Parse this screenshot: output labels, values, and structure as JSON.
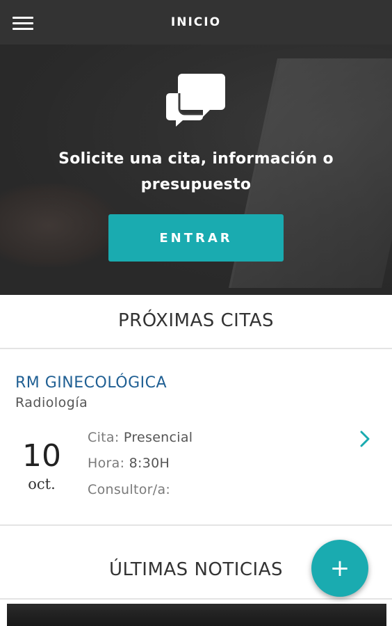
{
  "header": {
    "title": "INICIO",
    "menu_icon": "hamburger-menu-icon"
  },
  "hero": {
    "icon": "chat-bubbles-icon",
    "text_line1": "Solicite una cita, información o",
    "text_line2": "presupuesto",
    "button_label": "ENTRAR",
    "button_color": "#1aabb0"
  },
  "appointments": {
    "section_title": "PRÓXIMAS CITAS",
    "items": [
      {
        "title": "RM GINECOLÓGICA",
        "category": "Radiología",
        "day": "10",
        "month": "oct.",
        "type_label": "Cita:",
        "type_value": "Presencial",
        "time_label": "Hora:",
        "time_value": "8:30H",
        "consultant_label": "Consultor/a:",
        "consultant_value": ""
      }
    ]
  },
  "news": {
    "section_title": "ÚLTIMAS NOTICIAS"
  },
  "fab": {
    "label": "+",
    "color": "#1aabb0"
  },
  "colors": {
    "topbar": "#333333",
    "accent": "#1aabb0",
    "appointment_title": "#1f5f93"
  }
}
